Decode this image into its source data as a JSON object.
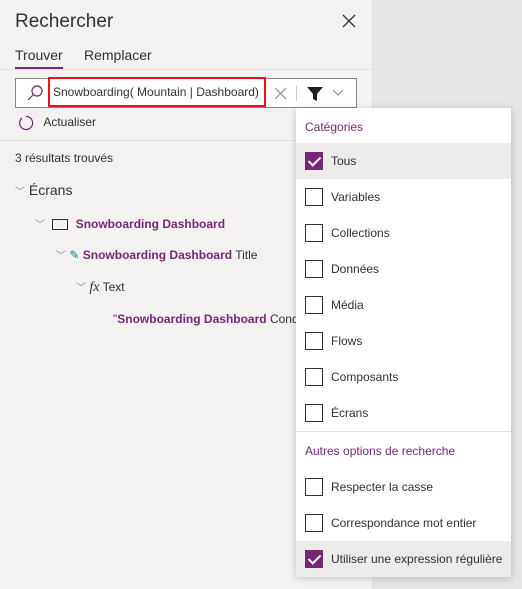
{
  "panel": {
    "title": "Rechercher",
    "tabs": [
      "Trouver",
      "Remplacer"
    ],
    "query": "Snowboarding( Mountain | Dashboard)",
    "refresh": "Actualiser",
    "results": "3 résultats trouvés"
  },
  "tree": {
    "group": "Écrans",
    "screen": "Snowboarding Dashboard",
    "control_bold": "Snowboarding Dashboard",
    "control_rest": " Title",
    "property": "Text",
    "value_quote": "\"",
    "value_bold": "Snowboarding Dashboard",
    "value_rest": " Cond"
  },
  "dropdown": {
    "categories_header": "Catégories",
    "categories": [
      {
        "label": "Tous",
        "checked": true
      },
      {
        "label": "Variables",
        "checked": false
      },
      {
        "label": "Collections",
        "checked": false
      },
      {
        "label": "Données",
        "checked": false
      },
      {
        "label": "Média",
        "checked": false
      },
      {
        "label": "Flows",
        "checked": false
      },
      {
        "label": "Composants",
        "checked": false
      },
      {
        "label": "Écrans",
        "checked": false
      }
    ],
    "other_header": "Autres options de recherche",
    "other": [
      {
        "label": "Respecter la casse",
        "checked": false
      },
      {
        "label": "Correspondance mot entier",
        "checked": false
      },
      {
        "label": "Utiliser une expression régulière",
        "checked": true
      }
    ]
  },
  "colors": {
    "accent": "#742774",
    "highlight": "#e81123"
  }
}
